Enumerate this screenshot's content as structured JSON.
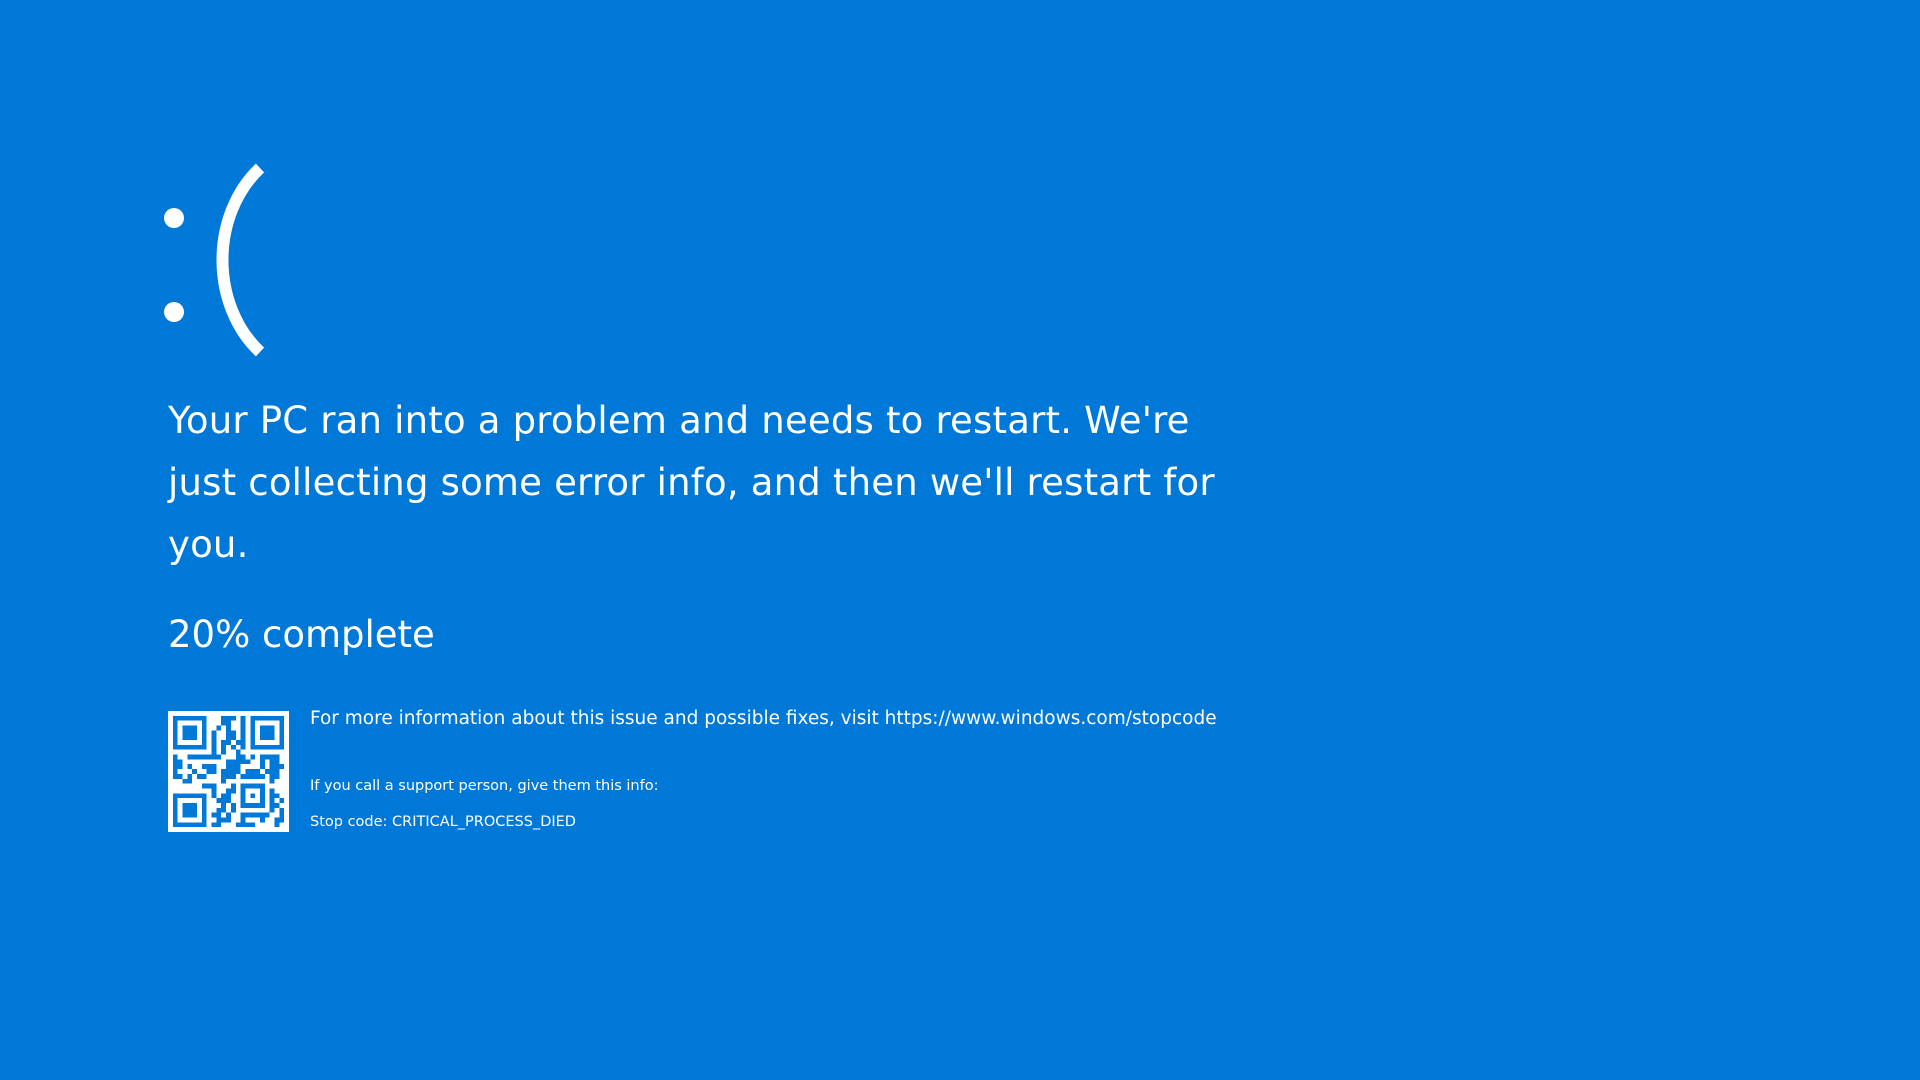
{
  "screen": {
    "background_color": "#0078d7",
    "text_color": "#ffffff",
    "frown_glyph": ":("
  },
  "message": {
    "text": "Your PC ran into a problem and needs to restart. We're just collecting some error info, and then we'll restart for you."
  },
  "progress": {
    "percent": 20,
    "text": "20% complete"
  },
  "details": {
    "qr_code_icon": "qr-code-icon",
    "more_info": "For more information about this issue and possible fixes, visit https://www.windows.com/stopcode",
    "support_hint": "If you call a support person, give them this info:",
    "stop_code_label": "Stop code: CRITICAL_PROCESS_DIED"
  }
}
